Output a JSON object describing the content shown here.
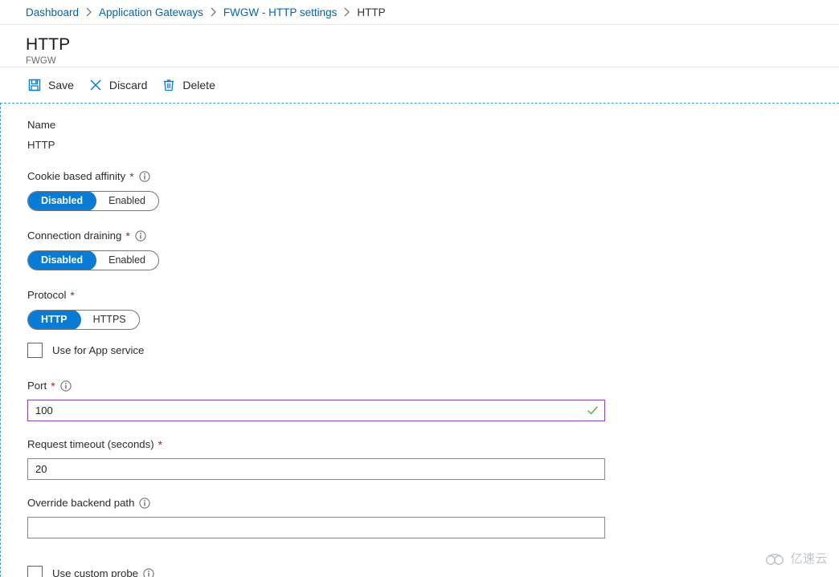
{
  "breadcrumb": {
    "items": [
      {
        "label": "Dashboard",
        "current": false
      },
      {
        "label": "Application Gateways",
        "current": false
      },
      {
        "label": "FWGW - HTTP settings",
        "current": false
      },
      {
        "label": "HTTP",
        "current": true
      }
    ],
    "separator_icon": "chevron-right-icon"
  },
  "header": {
    "title": "HTTP",
    "subtitle": "FWGW"
  },
  "toolbar": {
    "save_label": "Save",
    "save_icon": "save-disk-icon",
    "discard_label": "Discard",
    "discard_icon": "close-x-icon",
    "delete_label": "Delete",
    "delete_icon": "trash-can-icon"
  },
  "form": {
    "name": {
      "label": "Name",
      "value": "HTTP"
    },
    "cookie_affinity": {
      "label": "Cookie based affinity",
      "required": "*",
      "info_icon": "info-circle-icon",
      "options": [
        "Disabled",
        "Enabled"
      ],
      "selected": "Disabled"
    },
    "connection_draining": {
      "label": "Connection draining",
      "required": "*",
      "info_icon": "info-circle-icon",
      "options": [
        "Disabled",
        "Enabled"
      ],
      "selected": "Disabled"
    },
    "protocol": {
      "label": "Protocol",
      "required": "*",
      "options": [
        "HTTP",
        "HTTPS"
      ],
      "selected": "HTTP"
    },
    "use_app_service": {
      "label": "Use for App service",
      "checked": false
    },
    "port": {
      "label": "Port",
      "required": "*",
      "info_icon": "info-circle-icon",
      "value": "100",
      "placeholder": "",
      "validation_icon": "green-check-icon",
      "valid": true
    },
    "request_timeout": {
      "label": "Request timeout (seconds)",
      "required": "*",
      "value": "20",
      "placeholder": ""
    },
    "override_backend_path": {
      "label": "Override backend path",
      "info_icon": "info-circle-icon",
      "value": "",
      "placeholder": ""
    },
    "use_custom_probe": {
      "label": "Use custom probe",
      "info_icon": "info-circle-icon",
      "checked": false
    }
  },
  "watermark": {
    "text": "亿速云",
    "icon": "cloud-icon"
  },
  "colors": {
    "accent_blue": "#0a7bd4",
    "link_blue": "#0066b4",
    "required_red": "#a4262c",
    "valid_purple": "#8e44ad",
    "valid_green": "#6aa84f",
    "dashed_border": "#3c9fd0"
  }
}
